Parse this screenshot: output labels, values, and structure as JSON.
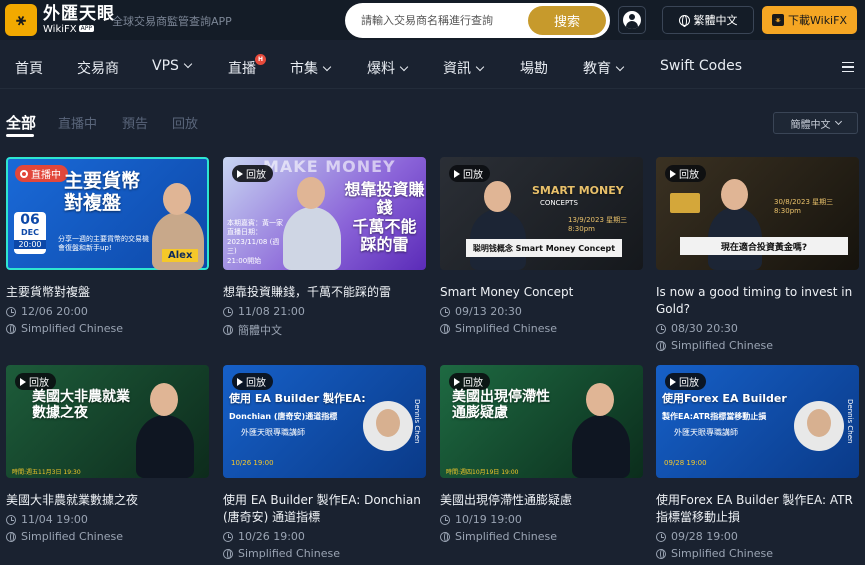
{
  "header": {
    "logo_cn": "外匯天眼",
    "logo_en": "WikiFX",
    "logo_app": "APP",
    "slogan": "全球交易商監管查詢APP",
    "search_placeholder": "請輸入交易商名稱進行查詢",
    "search_button": "搜索",
    "language": "繁體中文",
    "download": "下載WikiFX"
  },
  "nav": {
    "items": [
      {
        "label": "首頁"
      },
      {
        "label": "交易商"
      },
      {
        "label": "VPS"
      },
      {
        "label": "直播"
      },
      {
        "label": "市集"
      },
      {
        "label": "爆料"
      },
      {
        "label": "資訊"
      },
      {
        "label": "場勘"
      },
      {
        "label": "教育"
      },
      {
        "label": "Swift Codes"
      }
    ],
    "live_badge": "H"
  },
  "tabs": {
    "items": [
      "全部",
      "直播中",
      "預告",
      "回放"
    ],
    "filter": "簡體中文"
  },
  "cards": [
    {
      "badge": "直播中",
      "badge_type": "live",
      "thumb_title": "主要貨幣\n對複盤",
      "thumb_date_day": "06",
      "thumb_date_month": "DEC",
      "thumb_time": "20:00",
      "thumb_host": "Alex",
      "thumb_caption": "分享一週的主要貨幣的交易機會復盤和新手up!",
      "title": "主要貨幣對複盤",
      "time": "12/06 20:00",
      "language": "Simplified Chinese"
    },
    {
      "badge": "回放",
      "badge_type": "replay",
      "thumb_title": "想靠投資賺錢\n千萬不能\n踩的雷",
      "thumb_banner": "MAKE MONEY",
      "thumb_caption": "本期嘉賓：黃一家\n直播日期：\n2023/11/08 (週三)\n21:00開始",
      "title": "想靠投資賺錢，千萬不能踩的雷",
      "time": "11/08 21:00",
      "language": "簡體中文"
    },
    {
      "badge": "回放",
      "badge_type": "replay",
      "thumb_title": "SMART MONEY",
      "thumb_sub": "CONCEPTS",
      "thumb_caption": "聪明钱概念 Smart Money Concept",
      "thumb_date": "13/9/2023 星期三",
      "thumb_time": "8:30pm",
      "title": "Smart Money Concept",
      "time": "09/13 20:30",
      "language": "Simplified Chinese"
    },
    {
      "badge": "回放",
      "badge_type": "replay",
      "thumb_title": "現在適合投資黃金嗎?",
      "thumb_date": "30/8/2023 星期三",
      "thumb_time": "8:30pm",
      "title": "Is now a good timing to invest in Gold?",
      "time": "08/30 20:30",
      "language": "Simplified Chinese"
    },
    {
      "badge": "回放",
      "badge_type": "replay",
      "thumb_title": "美國大非農就業\n數據之夜",
      "thumb_time": "時間:週五11月3日 19:30",
      "title": "美國大非農就業數據之夜",
      "time": "11/04 19:00",
      "language": "Simplified Chinese"
    },
    {
      "badge": "回放",
      "badge_type": "replay",
      "thumb_title": "使用 EA Builder 製作EA:",
      "thumb_sub": "Donchian (唐奇安)通道指標",
      "thumb_caption": "外匯天眼專職講師",
      "thumb_host": "Dennis Chen",
      "thumb_time": "10/26 19:00",
      "title": "使用 EA Builder 製作EA: Donchian(唐奇安) 通道指標",
      "time": "10/26 19:00",
      "language": "Simplified Chinese"
    },
    {
      "badge": "回放",
      "badge_type": "replay",
      "thumb_title": "美國出現停滯性\n通膨疑慮",
      "thumb_time": "時間:週四10月19日 19:00",
      "title": "美國出現停滯性通膨疑慮",
      "time": "10/19 19:00",
      "language": "Simplified Chinese"
    },
    {
      "badge": "回放",
      "badge_type": "replay",
      "thumb_title": "使用Forex EA Builder",
      "thumb_sub": "製作EA:ATR指標當移動止損",
      "thumb_caption": "外匯天眼專職講師",
      "thumb_host": "Dennis Chen",
      "thumb_time": "09/28 19:00",
      "title": "使用Forex EA Builder 製作EA: ATR指標當移動止損",
      "time": "09/28 19:00",
      "language": "Simplified Chinese"
    }
  ],
  "colors": {
    "background": "#1a2230",
    "accent_gold": "#c79a2c",
    "download_orange": "#f5a623",
    "live_red": "#e2473b"
  },
  "icons": [
    "wikifx-logo-icon",
    "user-icon",
    "globe-icon",
    "chevron-down-icon",
    "menu-icon",
    "play-icon",
    "clock-icon",
    "language-icon"
  ]
}
